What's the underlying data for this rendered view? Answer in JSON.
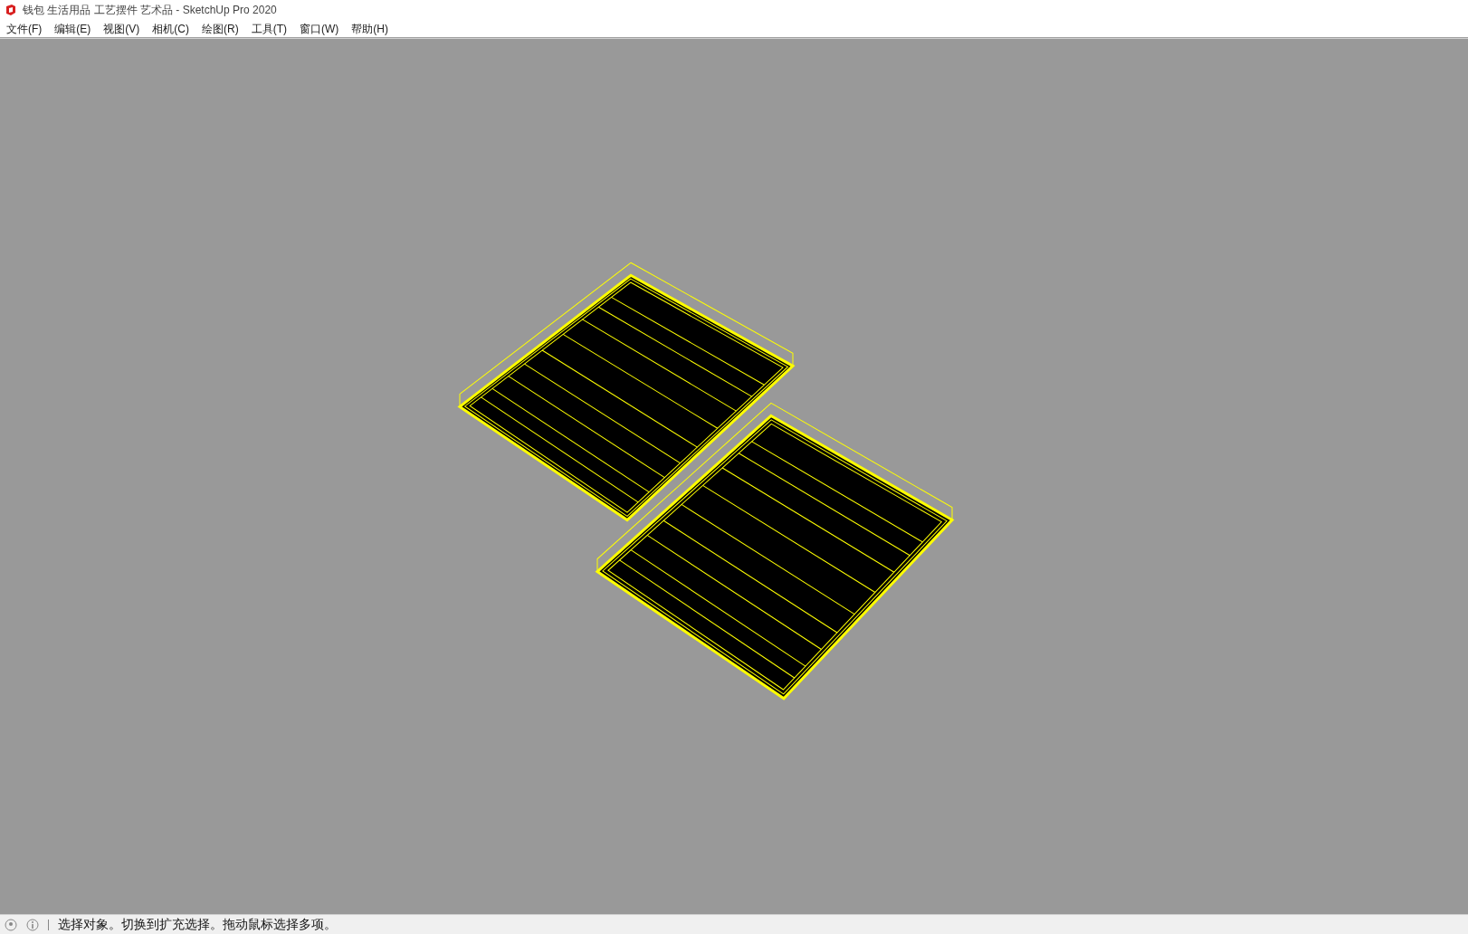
{
  "window": {
    "title": "钱包 生活用品 工艺摆件 艺术品 - SketchUp Pro 2020"
  },
  "menu": [
    "文件(F)",
    "编辑(E)",
    "视图(V)",
    "相机(C)",
    "绘图(R)",
    "工具(T)",
    "窗口(W)",
    "帮助(H)"
  ],
  "status_bar": {
    "message": "选择对象。切换到扩充选择。拖动鼠标选择多项。"
  }
}
